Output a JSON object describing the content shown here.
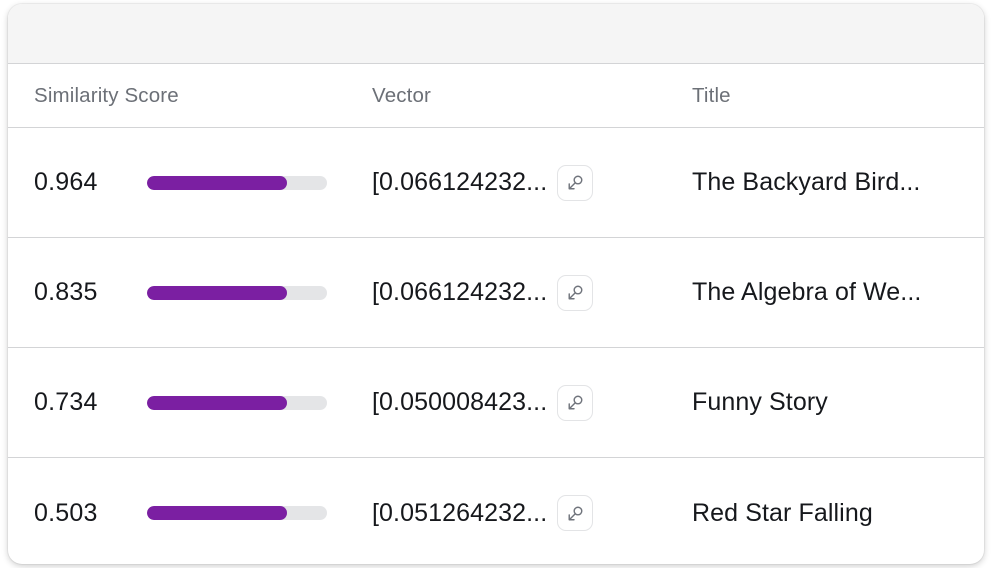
{
  "card": {
    "toolbar": {
      "label": ""
    },
    "accent_color": "#7b1fa2",
    "track_color": "#e4e5e7",
    "border_color": "#d3d4d6",
    "toolbar_color": "#f5f5f5"
  },
  "table": {
    "columns": [
      {
        "key": "score",
        "label": "Similarity Score"
      },
      {
        "key": "vector",
        "label": "Vector"
      },
      {
        "key": "title",
        "label": "Title"
      }
    ],
    "rows": [
      {
        "score": "0.964",
        "score_fill_percent": 78,
        "vector": "[0.066124232...",
        "vector_button_icon": "zoom-expand-icon",
        "title": "The Backyard Bird..."
      },
      {
        "score": "0.835",
        "score_fill_percent": 78,
        "vector": "[0.066124232...",
        "vector_button_icon": "zoom-expand-icon",
        "title": "The Algebra of We..."
      },
      {
        "score": "0.734",
        "score_fill_percent": 78,
        "vector": "[0.050008423...",
        "vector_button_icon": "zoom-expand-icon",
        "title": "Funny Story"
      },
      {
        "score": "0.503",
        "score_fill_percent": 78,
        "vector": "[0.051264232...",
        "vector_button_icon": "zoom-expand-icon",
        "title": "Red Star Falling"
      }
    ]
  }
}
